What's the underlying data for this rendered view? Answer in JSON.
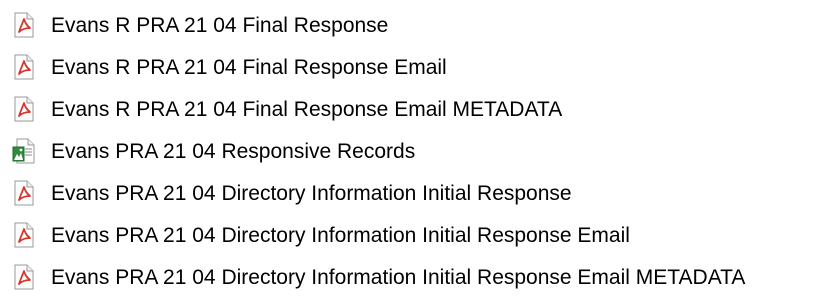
{
  "files": [
    {
      "name": "Evans R PRA 21 04 Final Response",
      "icon": "pdf-icon"
    },
    {
      "name": "Evans R PRA 21 04 Final Response Email",
      "icon": "pdf-icon"
    },
    {
      "name": "Evans R PRA 21 04 Final Response Email METADATA",
      "icon": "pdf-icon"
    },
    {
      "name": "Evans PRA 21 04 Responsive Records",
      "icon": "image-document-icon"
    },
    {
      "name": "Evans PRA 21 04 Directory Information Initial Response",
      "icon": "pdf-icon"
    },
    {
      "name": "Evans PRA 21 04 Directory Information Initial Response Email",
      "icon": "pdf-icon"
    },
    {
      "name": "Evans PRA 21 04 Directory Information Initial Response Email METADATA",
      "icon": "pdf-icon"
    }
  ],
  "colors": {
    "pdf_accent": "#d9342b",
    "image_accent": "#2e8b3e",
    "text": "#000000"
  }
}
